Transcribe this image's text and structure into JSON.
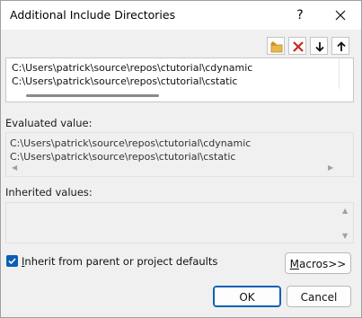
{
  "window": {
    "title": "Additional Include Directories",
    "help_label": "?"
  },
  "toolbar": {
    "buttons": [
      {
        "name": "new-line",
        "icon": "new-folder-icon"
      },
      {
        "name": "delete",
        "icon": "delete-x-icon"
      },
      {
        "name": "move-down",
        "icon": "arrow-down-icon"
      },
      {
        "name": "move-up",
        "icon": "arrow-up-icon"
      }
    ]
  },
  "paths": [
    "C:\\Users\\patrick\\source\\repos\\ctutorial\\cdynamic",
    "C:\\Users\\patrick\\source\\repos\\ctutorial\\cstatic"
  ],
  "evaluated": {
    "label": "Evaluated value:",
    "lines": [
      "C:\\Users\\patrick\\source\\repos\\ctutorial\\cdynamic",
      "C:\\Users\\patrick\\source\\repos\\ctutorial\\cstatic"
    ]
  },
  "inherited": {
    "label": "Inherited values:"
  },
  "inherit_checkbox": {
    "checked": true,
    "label_prefix": "I",
    "label_rest": "nherit from parent or project defaults"
  },
  "buttons": {
    "macros": {
      "prefix": "",
      "underlined": "M",
      "rest": "acros>>"
    },
    "ok": "OK",
    "cancel": "Cancel"
  },
  "colors": {
    "accent": "#0a5fb4",
    "delete_red": "#c42b1c",
    "folder_yellow": "#e8b84a"
  }
}
